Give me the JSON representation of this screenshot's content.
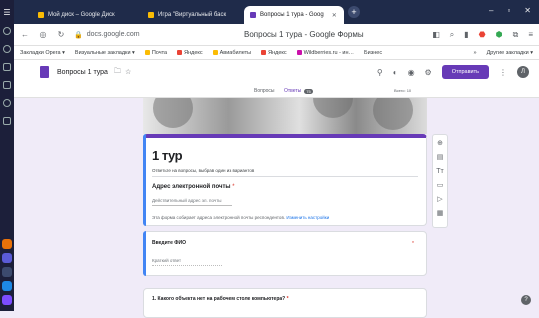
{
  "taskbar": {
    "dock": [
      {
        "name": "mail-app-icon",
        "color": "#e8710a"
      },
      {
        "name": "browser-app-icon",
        "color": "#5b5bd6"
      },
      {
        "name": "add-app-icon",
        "color": "#3c4a6e"
      },
      {
        "name": "play-app-icon",
        "color": "#1e88e5"
      },
      {
        "name": "circle-app-icon",
        "color": "#7c4dff"
      }
    ]
  },
  "browser": {
    "tabs": [
      {
        "label": "Мой диск – Google Диск",
        "color": "#fbbc04"
      },
      {
        "label": "Игра \"Виртуальный баск",
        "color": "#fbbc04"
      },
      {
        "label": "Вопросы 1 тура - Goog",
        "color": "#673ab7"
      }
    ],
    "url": "docs.google.com",
    "page_title": "Вопросы 1 тура - Google Формы",
    "bookmarks": [
      {
        "label": "Закладки Opera ▾",
        "color": ""
      },
      {
        "label": "Визуальные закладки ▾",
        "color": ""
      },
      {
        "label": "Почта",
        "color": "#fbbc04"
      },
      {
        "label": "Яндекс",
        "color": "#ea4335"
      },
      {
        "label": "Авиабилеты",
        "color": "#fbbc04"
      },
      {
        "label": "Яндекс",
        "color": "#ea4335"
      },
      {
        "label": "Wildberries.ru - ин…",
        "color": "#cb11ab"
      },
      {
        "label": "Бизнес",
        "color": ""
      },
      {
        "label": "»",
        "color": ""
      },
      {
        "label": "Другие закладки ▾",
        "color": ""
      }
    ]
  },
  "forms": {
    "doc_title": "Вопросы 1 тура",
    "send_label": "Отправить",
    "avatar_letter": "Л",
    "tab_questions": "Вопросы",
    "tab_answers": "Ответы",
    "answers_count": "75",
    "total": "Всего: 10"
  },
  "card1": {
    "title": "1 тур",
    "description": "Ответьте на вопросы, выбрав один из вариантов",
    "email_label": "Адрес электронной почты",
    "required_mark": "*",
    "email_placeholder": "Действительный адрес эл. почты",
    "note": "Эта форма собирает адреса электронной почты респондентов.",
    "note_link": "Изменить настройки"
  },
  "card2": {
    "question": "Введите ФИО",
    "required_mark": "*",
    "placeholder": "Краткий ответ"
  },
  "card3": {
    "question": "1. Какого объекта нет на рабочем столе компьютера?",
    "required_mark": "*"
  },
  "toolbar": [
    "⊕",
    "▤",
    "Tт",
    "▭",
    "▷",
    "▦"
  ]
}
